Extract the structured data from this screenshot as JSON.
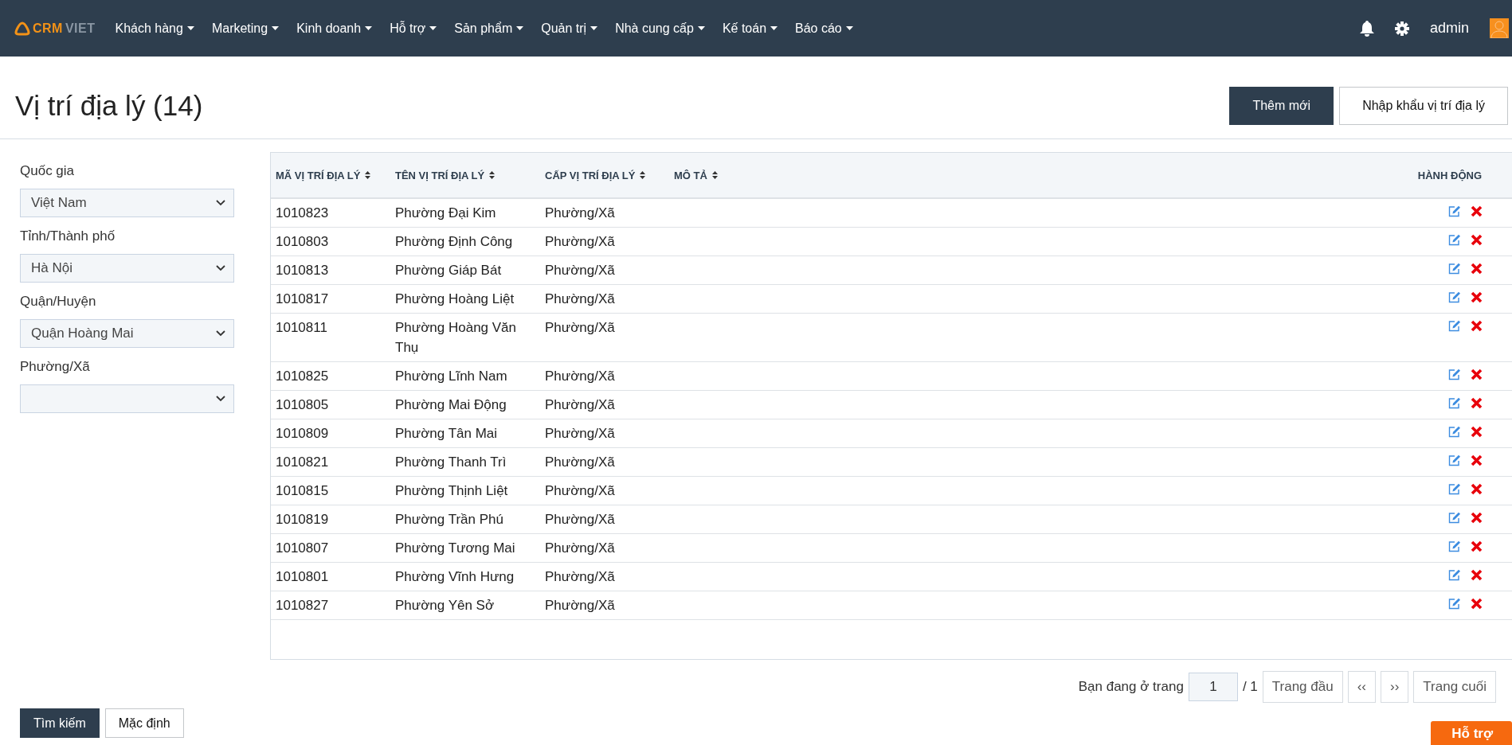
{
  "nav": {
    "logo": {
      "primary": "CRM",
      "secondary": "VIET"
    },
    "menu": [
      "Khách hàng",
      "Marketing",
      "Kinh doanh",
      "Hỗ trợ",
      "Sản phẩm",
      "Quản trị",
      "Nhà cung cấp",
      "Kế toán",
      "Báo cáo"
    ],
    "user": "admin"
  },
  "page": {
    "title": "Vị trí địa lý (14)",
    "buttons": [
      {
        "label": "Thêm mới",
        "kind": "primary"
      },
      {
        "label": "Nhập khẩu vị trí địa lý",
        "kind": "secondary"
      }
    ]
  },
  "filters": [
    {
      "label": "Quốc gia",
      "value": "Việt Nam"
    },
    {
      "label": "Tỉnh/Thành phố",
      "value": "Hà Nội"
    },
    {
      "label": "Quận/Huyện",
      "value": "Quận Hoàng Mai"
    },
    {
      "label": "Phường/Xã"
    }
  ],
  "filter_buttons": [
    {
      "label": "Tìm kiếm",
      "kind": "primary"
    },
    {
      "label": "Mặc định",
      "kind": "secondary"
    }
  ],
  "table": {
    "columns": [
      "MÃ VỊ TRÍ ĐỊA LÝ",
      "TÊN VỊ TRÍ ĐỊA LÝ",
      "CẤP VỊ TRÍ ĐỊA LÝ",
      "MÔ TẢ",
      "HÀNH ĐỘNG"
    ],
    "rows": [
      {
        "code": "1010823",
        "name": "Phường Đại Kim",
        "level": "Phường/Xã"
      },
      {
        "code": "1010803",
        "name": "Phường Định Công",
        "level": "Phường/Xã"
      },
      {
        "code": "1010813",
        "name": "Phường Giáp Bát",
        "level": "Phường/Xã"
      },
      {
        "code": "1010817",
        "name": "Phường Hoàng Liệt",
        "level": "Phường/Xã"
      },
      {
        "code": "1010811",
        "name": "Phường Hoàng Văn Thụ",
        "level": "Phường/Xã"
      },
      {
        "code": "1010825",
        "name": "Phường Lĩnh Nam",
        "level": "Phường/Xã"
      },
      {
        "code": "1010805",
        "name": "Phường Mai Động",
        "level": "Phường/Xã"
      },
      {
        "code": "1010809",
        "name": "Phường Tân Mai",
        "level": "Phường/Xã"
      },
      {
        "code": "1010821",
        "name": "Phường Thanh Trì",
        "level": "Phường/Xã"
      },
      {
        "code": "1010815",
        "name": "Phường Thịnh Liệt",
        "level": "Phường/Xã"
      },
      {
        "code": "1010819",
        "name": "Phường Trần Phú",
        "level": "Phường/Xã"
      },
      {
        "code": "1010807",
        "name": "Phường Tương Mai",
        "level": "Phường/Xã"
      },
      {
        "code": "1010801",
        "name": "Phường Vĩnh Hưng",
        "level": "Phường/Xã"
      },
      {
        "code": "1010827",
        "name": "Phường Yên Sở",
        "level": "Phường/Xã"
      }
    ]
  },
  "pagination": {
    "label": "Bạn đang ở trang",
    "page": "1",
    "total": "/ 1",
    "buttons": [
      "Trang đầu",
      "‹‹",
      "››",
      "Trang cuối"
    ]
  },
  "support_tab": "Hỗ trợ"
}
